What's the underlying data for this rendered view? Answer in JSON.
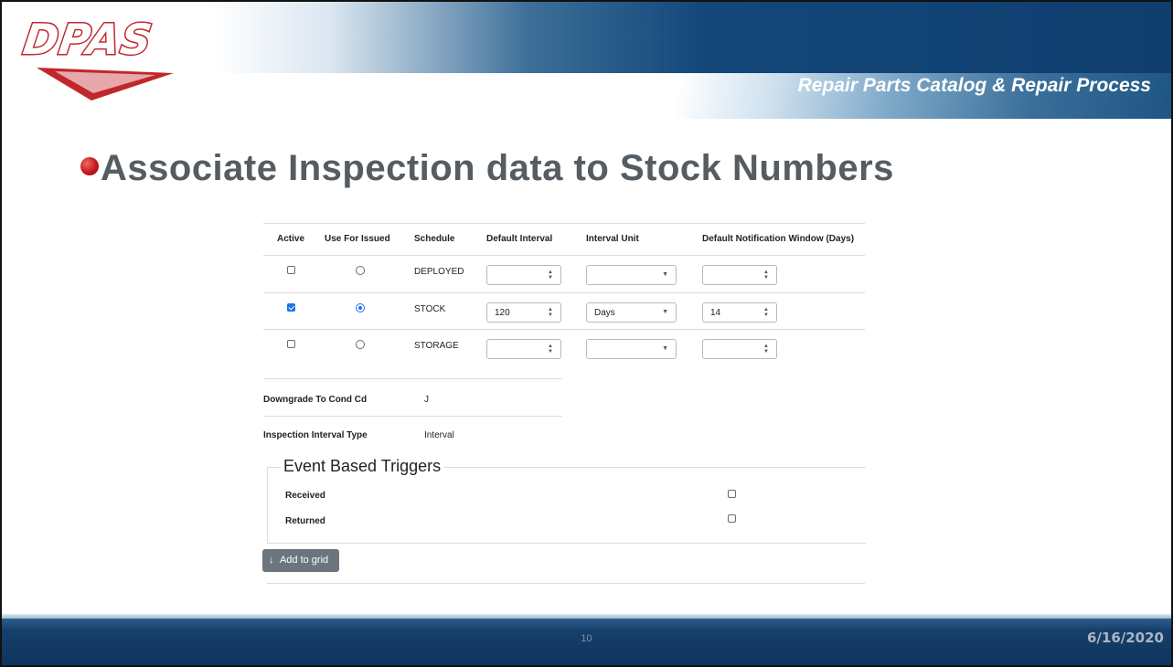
{
  "brand": {
    "logo_text": "DPAS"
  },
  "header": {
    "subtitle": "Repair Parts Catalog & Repair Process"
  },
  "slide": {
    "title": "Associate Inspection data to Stock Numbers"
  },
  "table": {
    "columns": [
      "Active",
      "Use For Issued",
      "Schedule",
      "Default Interval",
      "Interval Unit",
      "Default Notification Window (Days)"
    ],
    "rows": [
      {
        "active": false,
        "use_for_issued": false,
        "schedule": "DEPLOYED",
        "default_interval": "",
        "interval_unit": "",
        "notification_window": ""
      },
      {
        "active": true,
        "use_for_issued": true,
        "schedule": "STOCK",
        "default_interval": "120",
        "interval_unit": "Days",
        "notification_window": "14"
      },
      {
        "active": false,
        "use_for_issued": false,
        "schedule": "STORAGE",
        "default_interval": "",
        "interval_unit": "",
        "notification_window": ""
      }
    ]
  },
  "fields": {
    "downgrade_label": "Downgrade To Cond Cd",
    "downgrade_value": "J",
    "interval_type_label": "Inspection Interval Type",
    "interval_type_value": "Interval"
  },
  "event_triggers": {
    "legend": "Event Based Triggers",
    "items": [
      {
        "label": "Received",
        "checked": false
      },
      {
        "label": "Returned",
        "checked": false
      }
    ]
  },
  "add_button": {
    "icon": "arrow-down-icon",
    "glyph": "↓",
    "label": "Add to grid"
  },
  "footer": {
    "page_number": "10",
    "date": "6/16/2020"
  },
  "colors": {
    "accent": "#1a73e8",
    "header_blue": "#13477a",
    "bullet_red": "#c4161c",
    "title_gray": "#555c62",
    "button_gray": "#6c757d"
  }
}
